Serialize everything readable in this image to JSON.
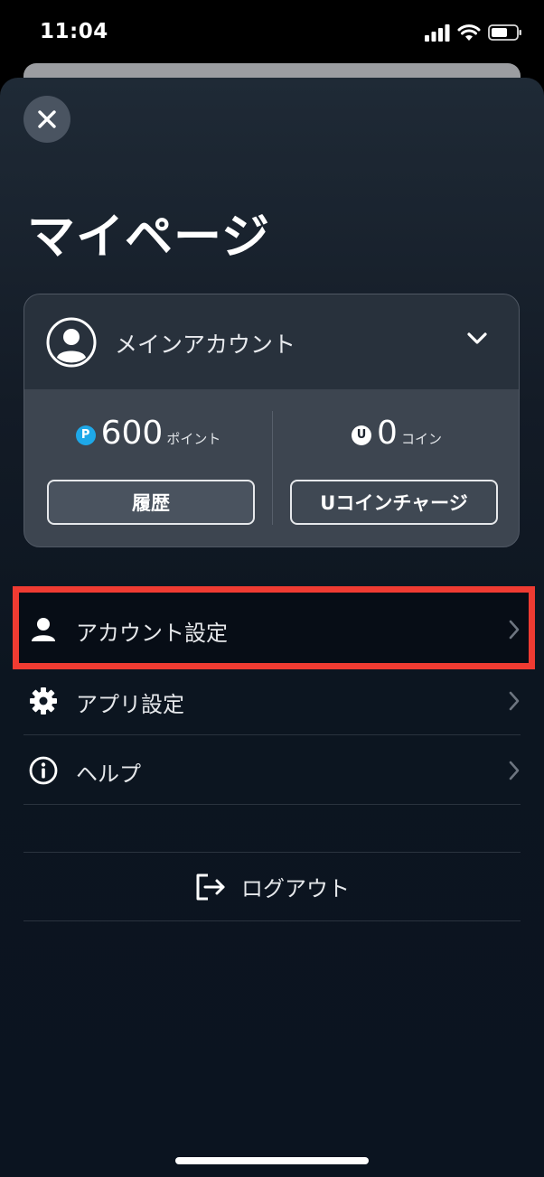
{
  "status_bar": {
    "time": "11:04"
  },
  "header": {
    "title": "マイページ"
  },
  "account": {
    "name": "メインアカウント"
  },
  "wallet": {
    "points": {
      "badge": "P",
      "value": "600",
      "unit": "ポイント",
      "button_label": "履歴"
    },
    "coins": {
      "badge": "U",
      "value": "0",
      "unit": "コイン",
      "button_label": "Uコインチャージ"
    }
  },
  "menu": {
    "items": [
      {
        "label": "アカウント設定",
        "icon": "person-icon"
      },
      {
        "label": "アプリ設定",
        "icon": "gear-icon"
      },
      {
        "label": "ヘルプ",
        "icon": "info-icon"
      }
    ],
    "logout_label": "ログアウト"
  },
  "colors": {
    "highlight": "#ef3b32",
    "points_badge": "#1ea8e8",
    "sheet_bg": "#0b1420"
  }
}
